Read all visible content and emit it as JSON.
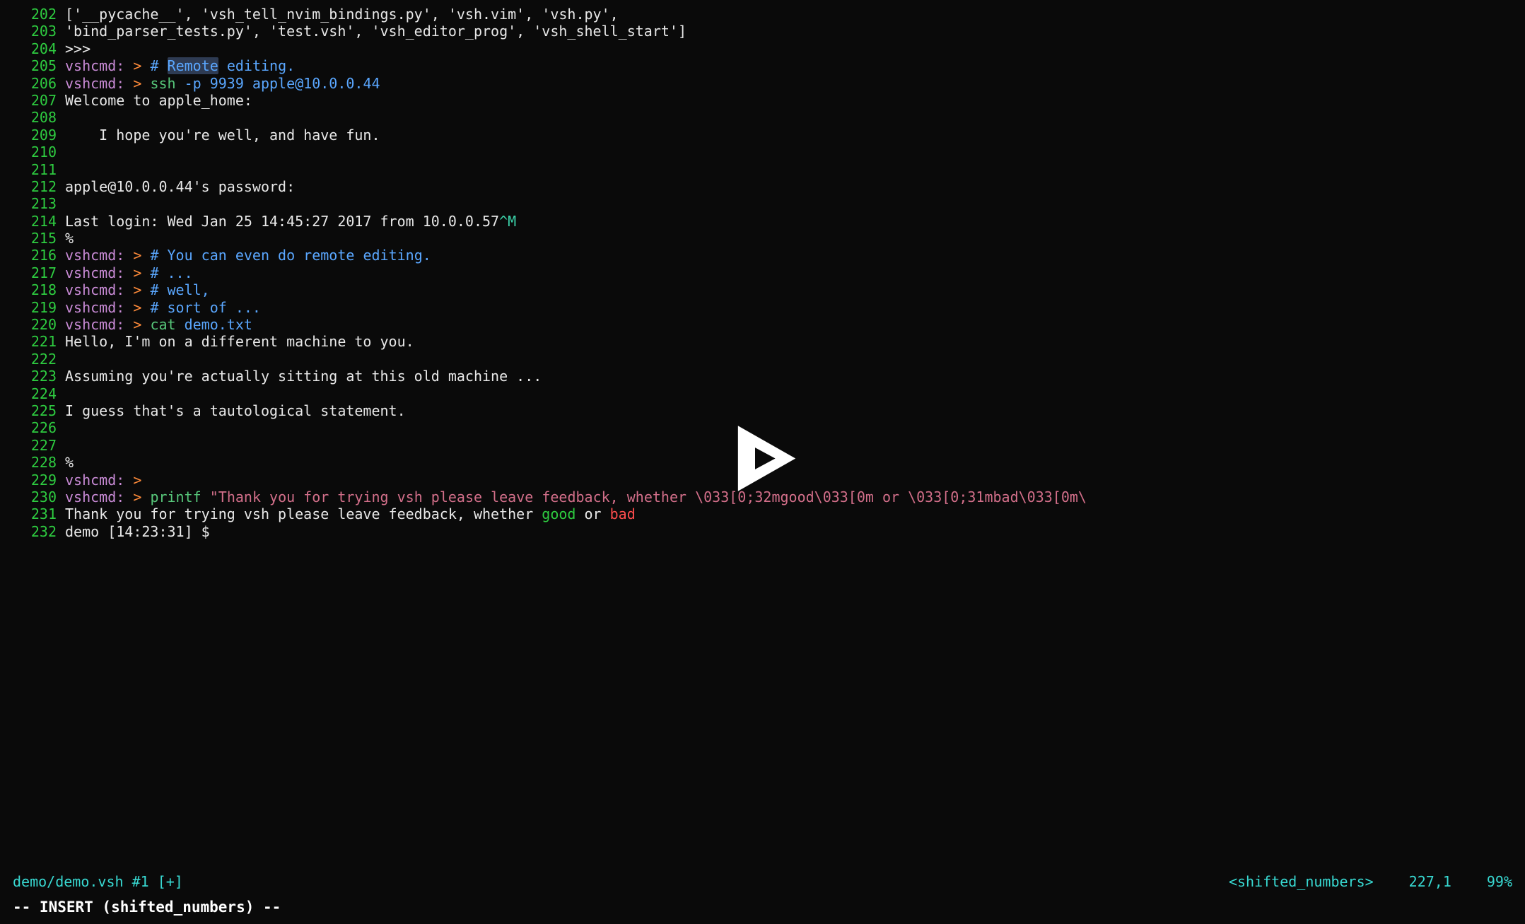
{
  "lines": [
    {
      "num": 202,
      "spans": [
        {
          "text": "['__pycache__', 'vsh_tell_nvim_bindings.py', 'vsh.vim', 'vsh.py',",
          "cls": "c-white"
        }
      ]
    },
    {
      "num": 203,
      "spans": [
        {
          "text": "'bind_parser_tests.py', 'test.vsh', 'vsh_editor_prog', 'vsh_shell_start']",
          "cls": "c-white"
        }
      ]
    },
    {
      "num": 204,
      "spans": [
        {
          "text": ">>>",
          "cls": "c-white"
        }
      ]
    },
    {
      "num": 205,
      "spans": [
        {
          "text": "vshcmd:",
          "cls": "c-purple"
        },
        {
          "text": " ",
          "cls": ""
        },
        {
          "text": ">",
          "cls": "c-gt"
        },
        {
          "text": " ",
          "cls": ""
        },
        {
          "text": "# ",
          "cls": "c-blue"
        },
        {
          "text": "Remote",
          "cls": "c-blue hl"
        },
        {
          "text": " editing.",
          "cls": "c-blue"
        }
      ]
    },
    {
      "num": 206,
      "spans": [
        {
          "text": "vshcmd:",
          "cls": "c-purple"
        },
        {
          "text": " ",
          "cls": ""
        },
        {
          "text": ">",
          "cls": "c-gt"
        },
        {
          "text": " ",
          "cls": ""
        },
        {
          "text": "ssh",
          "cls": "c-cmd"
        },
        {
          "text": " -p 9939 apple@10.0.0.44",
          "cls": "c-blue"
        }
      ]
    },
    {
      "num": 207,
      "spans": [
        {
          "text": "Welcome to apple_home:",
          "cls": "c-white"
        }
      ]
    },
    {
      "num": 208,
      "spans": [
        {
          "text": "",
          "cls": ""
        }
      ]
    },
    {
      "num": 209,
      "spans": [
        {
          "text": "    I hope you're well, and have fun.",
          "cls": "c-white"
        }
      ]
    },
    {
      "num": 210,
      "spans": [
        {
          "text": "",
          "cls": ""
        }
      ]
    },
    {
      "num": 211,
      "spans": [
        {
          "text": "",
          "cls": ""
        }
      ]
    },
    {
      "num": 212,
      "spans": [
        {
          "text": "apple@10.0.0.44's password:",
          "cls": "c-white"
        }
      ]
    },
    {
      "num": 213,
      "spans": [
        {
          "text": "",
          "cls": ""
        }
      ]
    },
    {
      "num": 214,
      "spans": [
        {
          "text": "Last login: Wed Jan 25 14:45:27 2017 from 10.0.0.57",
          "cls": "c-white"
        },
        {
          "text": "^M",
          "cls": "c-caret"
        }
      ]
    },
    {
      "num": 215,
      "spans": [
        {
          "text": "%",
          "cls": "c-white"
        }
      ]
    },
    {
      "num": 216,
      "spans": [
        {
          "text": "vshcmd:",
          "cls": "c-purple"
        },
        {
          "text": " ",
          "cls": ""
        },
        {
          "text": ">",
          "cls": "c-gt"
        },
        {
          "text": " ",
          "cls": ""
        },
        {
          "text": "# You can even do remote editing.",
          "cls": "c-blue"
        }
      ]
    },
    {
      "num": 217,
      "spans": [
        {
          "text": "vshcmd:",
          "cls": "c-purple"
        },
        {
          "text": " ",
          "cls": ""
        },
        {
          "text": ">",
          "cls": "c-gt"
        },
        {
          "text": " ",
          "cls": ""
        },
        {
          "text": "# ...",
          "cls": "c-blue"
        }
      ]
    },
    {
      "num": 218,
      "spans": [
        {
          "text": "vshcmd:",
          "cls": "c-purple"
        },
        {
          "text": " ",
          "cls": ""
        },
        {
          "text": ">",
          "cls": "c-gt"
        },
        {
          "text": " ",
          "cls": ""
        },
        {
          "text": "# well,",
          "cls": "c-blue"
        }
      ]
    },
    {
      "num": 219,
      "spans": [
        {
          "text": "vshcmd:",
          "cls": "c-purple"
        },
        {
          "text": " ",
          "cls": ""
        },
        {
          "text": ">",
          "cls": "c-gt"
        },
        {
          "text": " ",
          "cls": ""
        },
        {
          "text": "# sort of ...",
          "cls": "c-blue"
        }
      ]
    },
    {
      "num": 220,
      "spans": [
        {
          "text": "vshcmd:",
          "cls": "c-purple"
        },
        {
          "text": " ",
          "cls": ""
        },
        {
          "text": ">",
          "cls": "c-gt"
        },
        {
          "text": " ",
          "cls": ""
        },
        {
          "text": "cat",
          "cls": "c-cmd"
        },
        {
          "text": " demo.txt",
          "cls": "c-blue"
        }
      ]
    },
    {
      "num": 221,
      "spans": [
        {
          "text": "Hello, I'm on a different machine to you.",
          "cls": "c-white"
        }
      ]
    },
    {
      "num": 222,
      "spans": [
        {
          "text": "",
          "cls": ""
        }
      ]
    },
    {
      "num": 223,
      "spans": [
        {
          "text": "Assuming you're actually sitting at this old machine ...",
          "cls": "c-white"
        }
      ]
    },
    {
      "num": 224,
      "spans": [
        {
          "text": "",
          "cls": ""
        }
      ]
    },
    {
      "num": 225,
      "spans": [
        {
          "text": "I guess that's a tautological statement.",
          "cls": "c-white"
        }
      ]
    },
    {
      "num": 226,
      "spans": [
        {
          "text": "",
          "cls": ""
        }
      ]
    },
    {
      "num": 227,
      "spans": [
        {
          "text": "",
          "cls": ""
        }
      ]
    },
    {
      "num": 228,
      "spans": [
        {
          "text": "%",
          "cls": "c-white"
        }
      ]
    },
    {
      "num": 229,
      "spans": [
        {
          "text": "vshcmd:",
          "cls": "c-purple"
        },
        {
          "text": " ",
          "cls": ""
        },
        {
          "text": ">",
          "cls": "c-gt"
        },
        {
          "text": " ",
          "cls": ""
        }
      ]
    },
    {
      "num": 230,
      "spans": [
        {
          "text": "vshcmd:",
          "cls": "c-purple"
        },
        {
          "text": " ",
          "cls": ""
        },
        {
          "text": ">",
          "cls": "c-gt"
        },
        {
          "text": " ",
          "cls": ""
        },
        {
          "text": "printf",
          "cls": "c-cmd"
        },
        {
          "text": " ",
          "cls": ""
        },
        {
          "text": "\"Thank you for trying vsh please leave feedback, whether \\033[0;32mgood\\033[0m or \\033[0;31mbad\\033[0m\\",
          "cls": "c-str"
        }
      ]
    },
    {
      "num": 231,
      "spans": [
        {
          "text": "Thank you for trying vsh please leave feedback, whether ",
          "cls": "c-white"
        },
        {
          "text": "good",
          "cls": "c-good"
        },
        {
          "text": " or ",
          "cls": "c-white"
        },
        {
          "text": "bad",
          "cls": "c-bad"
        }
      ]
    },
    {
      "num": 232,
      "spans": [
        {
          "text": "demo [14:23:31] $ ",
          "cls": "c-white"
        }
      ]
    }
  ],
  "status": {
    "left": "demo/demo.vsh #1 [+]",
    "keymap": "<shifted_numbers>",
    "cursor": "227,1",
    "scrollpct": "99%"
  },
  "modeline": "-- INSERT (shifted_numbers) --"
}
